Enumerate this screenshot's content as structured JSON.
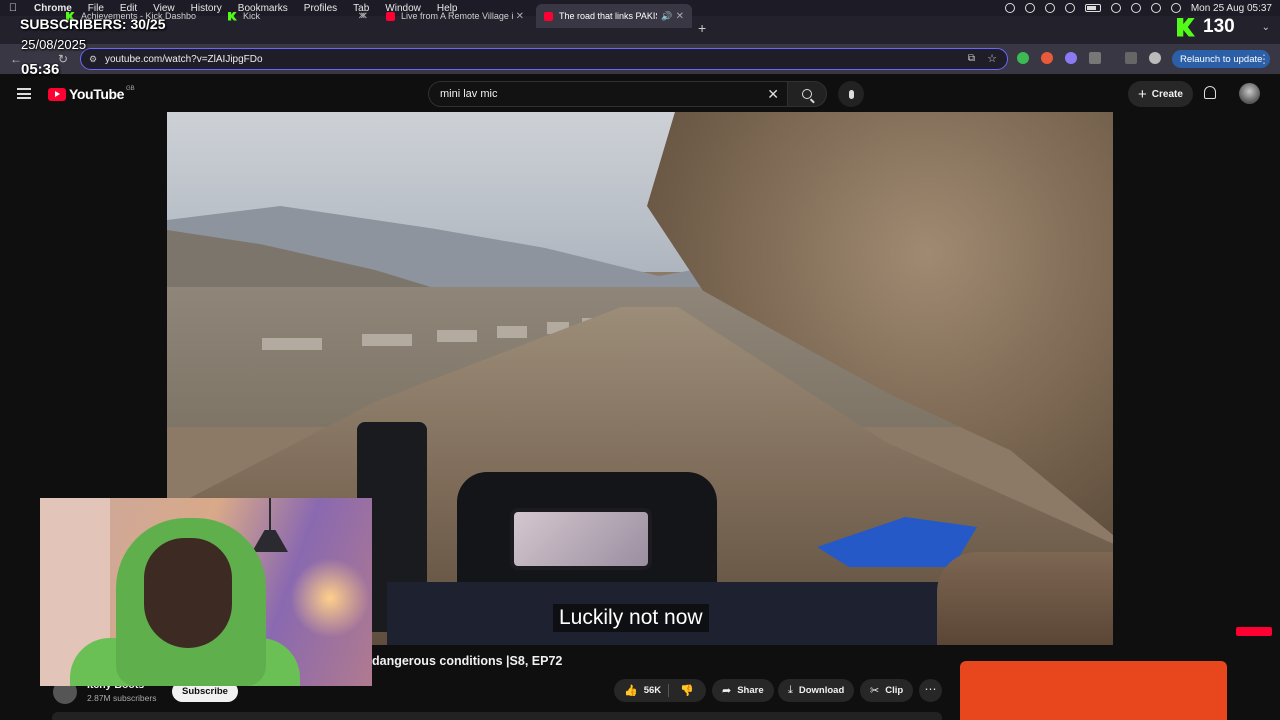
{
  "menubar": {
    "app": "Chrome",
    "items": [
      "File",
      "Edit",
      "View",
      "History",
      "Bookmarks",
      "Profiles",
      "Tab",
      "Window",
      "Help"
    ],
    "datetime": "Mon 25 Aug  05:37"
  },
  "tabs": [
    {
      "label": "Achievements - Kick Dashbo",
      "favicon": "kick",
      "active": false
    },
    {
      "label": "Kick",
      "favicon": "kick",
      "active": false
    },
    {
      "label": "Live from A Remote Village in",
      "favicon": "youtube",
      "active": false
    },
    {
      "label": "The road that links PAKIS",
      "favicon": "youtube",
      "active": true
    }
  ],
  "address": {
    "url": "youtube.com/watch?v=ZlAIJipgFDo",
    "relaunch_label": "Relaunch to update"
  },
  "overlay": {
    "subscribers": "SUBSCRIBERS: 30/25",
    "date": "25/08/2025",
    "time": "05:36",
    "kick_count": "130"
  },
  "youtube": {
    "logo_text": "YouTube",
    "country": "GB",
    "search_value": "mini lav mic",
    "create_label": "Create"
  },
  "video": {
    "caption": "Luckily not now",
    "title_visible": "dangerous conditions |S8, EP72"
  },
  "channel": {
    "name": "Itchy Boots",
    "subscribers": "2.87M subscribers",
    "subscribe_label": "Subscribe"
  },
  "actions": {
    "likes": "56K",
    "share": "Share",
    "download": "Download",
    "clip": "Clip"
  },
  "colors": {
    "kick_green": "#53fc18",
    "youtube_red": "#ff0033",
    "relaunch_blue": "#2b5fa8",
    "ad_orange": "#e8461d"
  }
}
